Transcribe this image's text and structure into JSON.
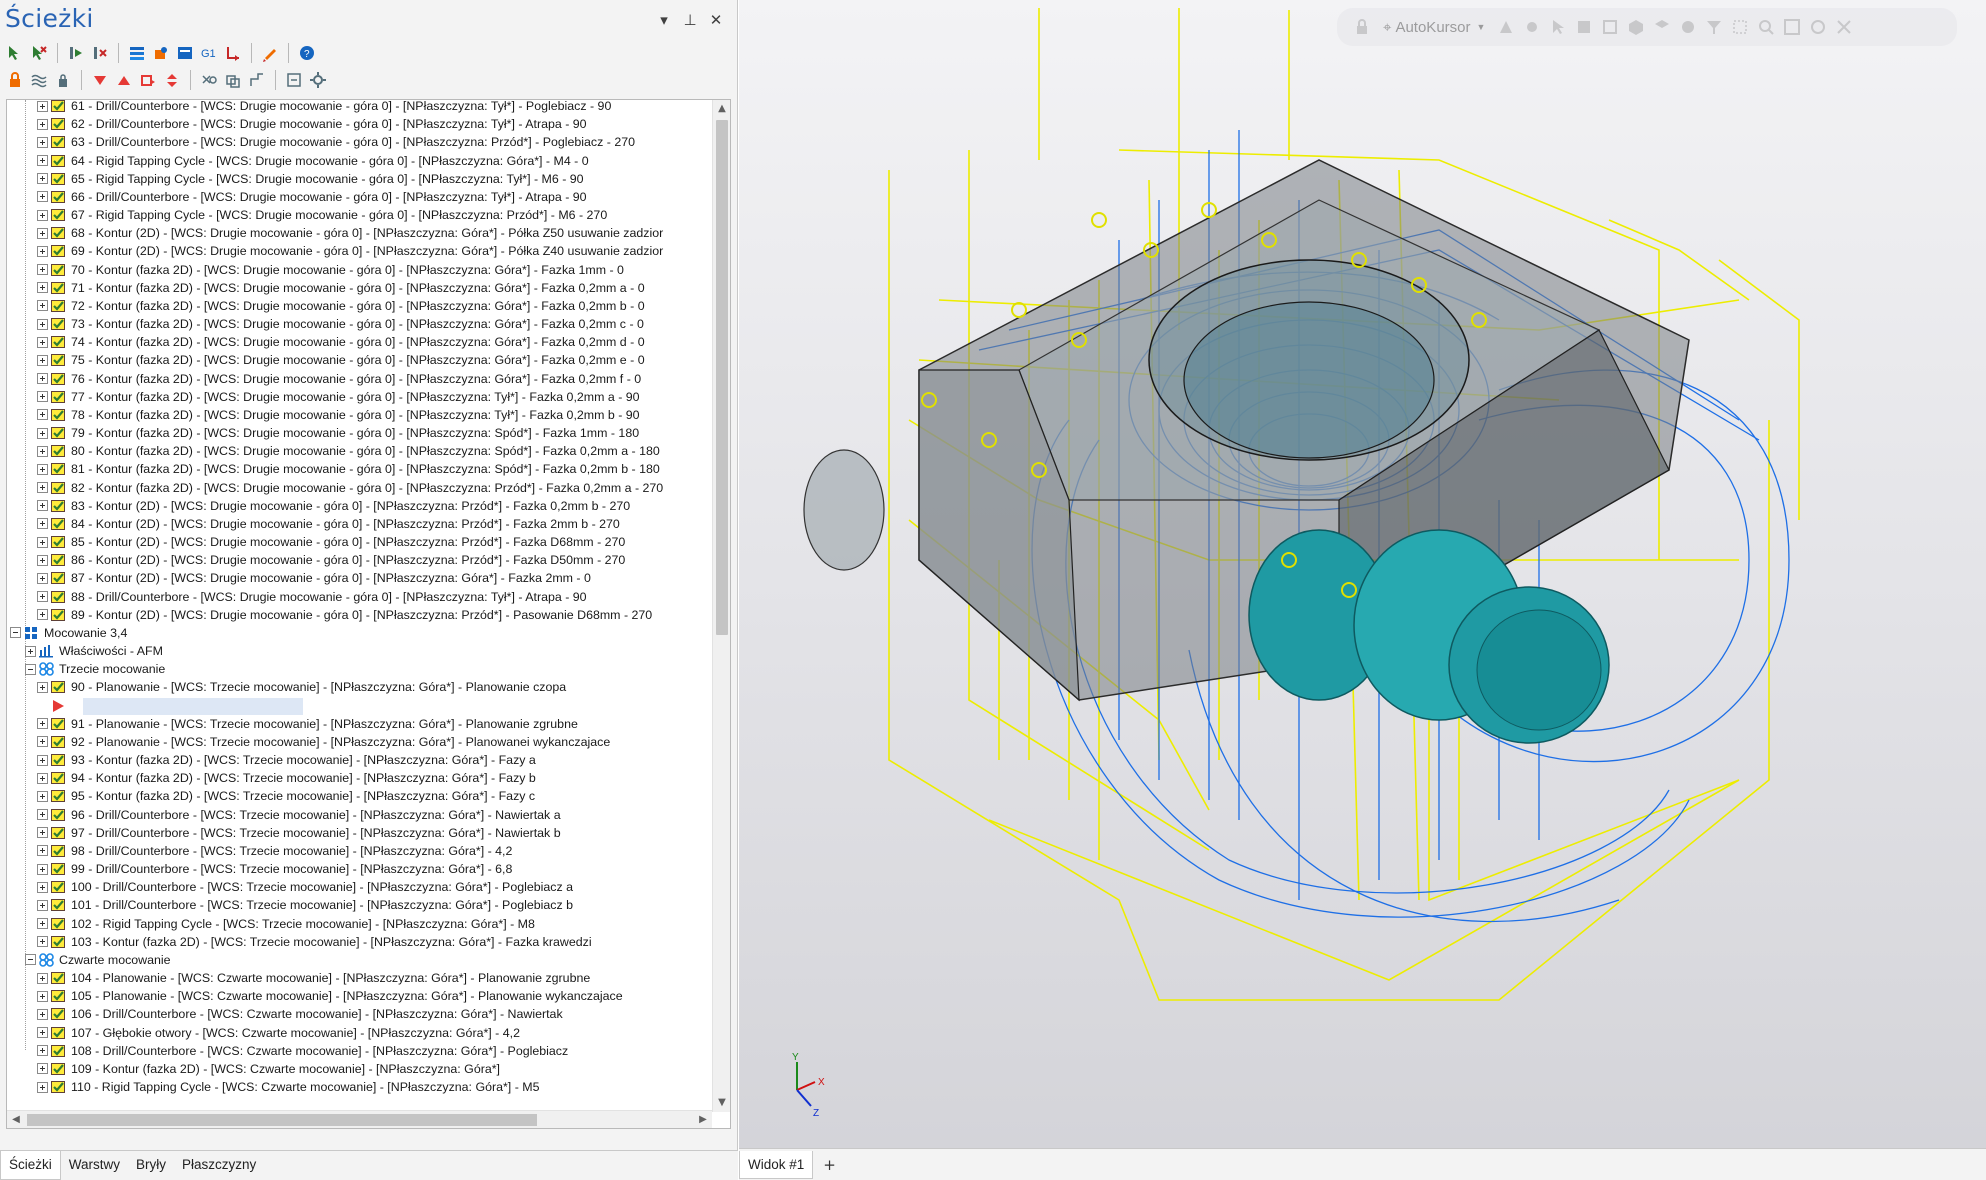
{
  "panel": {
    "title": "Ścieżki",
    "controls": {
      "menu": "▾",
      "pin": "⊥",
      "close": "✕"
    }
  },
  "toolbar_row_1": [
    {
      "name": "select-toolpath-icon"
    },
    {
      "name": "deselect-toolpath-icon"
    },
    {
      "sep": true
    },
    {
      "name": "regenerate-icon"
    },
    {
      "name": "delete-toolpath-icon"
    },
    {
      "sep": true
    },
    {
      "name": "layers-icon"
    },
    {
      "name": "stock-icon"
    },
    {
      "name": "simulate-icon"
    },
    {
      "name": "g1-icon"
    },
    {
      "name": "post-icon"
    },
    {
      "sep": true
    },
    {
      "name": "edit-icon"
    },
    {
      "sep": true
    },
    {
      "name": "help-icon"
    }
  ],
  "toolbar_row_2": [
    {
      "name": "lock-icon"
    },
    {
      "name": "wave-icon"
    },
    {
      "name": "padlock-icon"
    },
    {
      "sep": true
    },
    {
      "name": "move-down-icon"
    },
    {
      "name": "move-up-icon"
    },
    {
      "name": "move-to-icon"
    },
    {
      "name": "reorder-icon"
    },
    {
      "sep": true
    },
    {
      "name": "copy-icon"
    },
    {
      "name": "link-icon"
    },
    {
      "name": "attach-icon"
    },
    {
      "sep": true
    },
    {
      "name": "tool-icon"
    },
    {
      "name": "settings-icon"
    }
  ],
  "tree": {
    "operations_a": [
      "61 - Drill/Counterbore - [WCS: Drugie mocowanie - góra 0] - [NPłaszczyzna: Tył*] - Poglebiacz - 90",
      "62 - Drill/Counterbore - [WCS: Drugie mocowanie - góra 0] - [NPłaszczyzna: Tył*] - Atrapa - 90",
      "63 - Drill/Counterbore - [WCS: Drugie mocowanie - góra 0] - [NPłaszczyzna: Przód*] - Poglebiacz - 270",
      "64 - Rigid Tapping Cycle - [WCS: Drugie mocowanie - góra 0] - [NPłaszczyzna: Góra*] - M4 - 0",
      "65 - Rigid Tapping Cycle - [WCS: Drugie mocowanie - góra 0] - [NPłaszczyzna: Tył*] - M6 - 90",
      "66 - Drill/Counterbore - [WCS: Drugie mocowanie - góra 0] - [NPłaszczyzna: Tył*] - Atrapa - 90",
      "67 - Rigid Tapping Cycle - [WCS: Drugie mocowanie - góra 0] - [NPłaszczyzna: Przód*] - M6 - 270",
      "68 - Kontur (2D) - [WCS: Drugie mocowanie - góra 0] - [NPłaszczyzna: Góra*] - Półka Z50 usuwanie zadzior",
      "69 - Kontur (2D) - [WCS: Drugie mocowanie - góra 0] - [NPłaszczyzna: Góra*] - Półka Z40 usuwanie zadzior",
      "70 - Kontur (fazka 2D) - [WCS: Drugie mocowanie - góra 0] - [NPłaszczyzna: Góra*] - Fazka 1mm - 0",
      "71 - Kontur (fazka 2D) - [WCS: Drugie mocowanie - góra 0] - [NPłaszczyzna: Góra*] - Fazka 0,2mm a - 0",
      "72 - Kontur (fazka 2D) - [WCS: Drugie mocowanie - góra 0] - [NPłaszczyzna: Góra*] - Fazka 0,2mm b - 0",
      "73 - Kontur (fazka 2D) - [WCS: Drugie mocowanie - góra 0] - [NPłaszczyzna: Góra*] - Fazka 0,2mm c - 0",
      "74 - Kontur (fazka 2D) - [WCS: Drugie mocowanie - góra 0] - [NPłaszczyzna: Góra*] - Fazka 0,2mm d - 0",
      "75 - Kontur (fazka 2D) - [WCS: Drugie mocowanie - góra 0] - [NPłaszczyzna: Góra*] - Fazka 0,2mm e - 0",
      "76 - Kontur (fazka 2D) - [WCS: Drugie mocowanie - góra 0] - [NPłaszczyzna: Góra*] - Fazka 0,2mm f - 0",
      "77 - Kontur (fazka 2D) - [WCS: Drugie mocowanie - góra 0] - [NPłaszczyzna: Tył*] - Fazka 0,2mm a - 90",
      "78 - Kontur (fazka 2D) - [WCS: Drugie mocowanie - góra 0] - [NPłaszczyzna: Tył*] - Fazka 0,2mm b - 90",
      "79 - Kontur (fazka 2D) - [WCS: Drugie mocowanie - góra 0] - [NPłaszczyzna: Spód*] - Fazka 1mm - 180",
      "80 - Kontur (fazka 2D) - [WCS: Drugie mocowanie - góra 0] - [NPłaszczyzna: Spód*] - Fazka 0,2mm a - 180",
      "81 - Kontur (fazka 2D) - [WCS: Drugie mocowanie - góra 0] - [NPłaszczyzna: Spód*] - Fazka 0,2mm b - 180",
      "82 - Kontur (fazka 2D) - [WCS: Drugie mocowanie - góra 0] - [NPłaszczyzna: Przód*] - Fazka 0,2mm a - 270",
      "83 - Kontur (2D) - [WCS: Drugie mocowanie - góra 0] - [NPłaszczyzna: Przód*] - Fazka 0,2mm b - 270",
      "84 - Kontur (2D) - [WCS: Drugie mocowanie - góra 0] - [NPłaszczyzna: Przód*] - Fazka 2mm b - 270",
      "85 - Kontur (2D) - [WCS: Drugie mocowanie - góra 0] - [NPłaszczyzna: Przód*] - Fazka D68mm - 270",
      "86 - Kontur (2D) - [WCS: Drugie mocowanie - góra 0] - [NPłaszczyzna: Przód*] - Fazka D50mm - 270",
      "87 - Kontur (2D) - [WCS: Drugie mocowanie - góra 0] - [NPłaszczyzna: Góra*] - Fazka 2mm - 0",
      "88 - Drill/Counterbore - [WCS: Drugie mocowanie - góra 0] - [NPłaszczyzna: Tył*] - Atrapa - 90",
      "89 - Kontur (2D) - [WCS: Drugie mocowanie - góra 0] - [NPłaszczyzna: Przód*] - Pasowanie D68mm - 270"
    ],
    "group_label": "Mocowanie 3,4",
    "properties_label": "Właściwości - AFM",
    "setup3_label": "Trzecie mocowanie",
    "setup3_ops_first": [
      "90 - Planowanie - [WCS: Trzecie mocowanie] - [NPłaszczyzna: Góra*] - Planowanie czopa"
    ],
    "setup3_ops": [
      "91 - Planowanie - [WCS: Trzecie mocowanie] - [NPłaszczyzna: Góra*] - Planowanie zgrubne",
      "92 - Planowanie - [WCS: Trzecie mocowanie] - [NPłaszczyzna: Góra*] - Planowanei wykanczajace",
      "93 - Kontur (fazka 2D) - [WCS: Trzecie mocowanie] - [NPłaszczyzna: Góra*] - Fazy a",
      "94 - Kontur (fazka 2D) - [WCS: Trzecie mocowanie] - [NPłaszczyzna: Góra*] - Fazy b",
      "95 - Kontur (fazka 2D) - [WCS: Trzecie mocowanie] - [NPłaszczyzna: Góra*] - Fazy c",
      "96 - Drill/Counterbore - [WCS: Trzecie mocowanie] - [NPłaszczyzna: Góra*] - Nawiertak a",
      "97 - Drill/Counterbore - [WCS: Trzecie mocowanie] - [NPłaszczyzna: Góra*] - Nawiertak b",
      "98 - Drill/Counterbore - [WCS: Trzecie mocowanie] - [NPłaszczyzna: Góra*] - 4,2",
      "99 - Drill/Counterbore - [WCS: Trzecie mocowanie] - [NPłaszczyzna: Góra*] - 6,8",
      "100 - Drill/Counterbore - [WCS: Trzecie mocowanie] - [NPłaszczyzna: Góra*] - Poglebiacz a",
      "101 - Drill/Counterbore - [WCS: Trzecie mocowanie] - [NPłaszczyzna: Góra*] - Poglebiacz b",
      "102 - Rigid Tapping Cycle - [WCS: Trzecie mocowanie] - [NPłaszczyzna: Góra*] - M8",
      "103 - Kontur (fazka 2D) - [WCS: Trzecie mocowanie] - [NPłaszczyzna: Góra*] - Fazka krawedzi"
    ],
    "setup4_label": "Czwarte mocowanie",
    "setup4_ops": [
      "104 - Planowanie - [WCS: Czwarte mocowanie] - [NPłaszczyzna: Góra*] - Planowanie zgrubne",
      "105 - Planowanie - [WCS: Czwarte mocowanie] - [NPłaszczyzna: Góra*] - Planowanie wykanczajace",
      "106 - Drill/Counterbore - [WCS: Czwarte mocowanie] - [NPłaszczyzna: Góra*] - Nawiertak",
      "107 - Głębokie otwory - [WCS: Czwarte mocowanie] - [NPłaszczyzna: Góra*] - 4,2",
      "108 - Drill/Counterbore - [WCS: Czwarte mocowanie] - [NPłaszczyzna: Góra*] - Poglebiacz",
      "109 - Kontur (fazka 2D) - [WCS: Czwarte mocowanie] - [NPłaszczyzna: Góra*]",
      "110 - Rigid Tapping Cycle - [WCS: Czwarte mocowanie] - [NPłaszczyzna: Góra*] - M5"
    ]
  },
  "bottom_tabs": [
    "Ścieżki",
    "Warstwy",
    "Bryły",
    "Płaszczyzny"
  ],
  "viewport": {
    "autokursor_label": "AutoKursor",
    "axes": {
      "x": "X",
      "y": "Y",
      "z": "Z"
    },
    "colors": {
      "toolpath_blue": "#1e6fe6",
      "stock_yellow": "#f0f000",
      "part_teal": "#27a9b0",
      "part_gray": "#6b7378"
    }
  },
  "viewport_tabs": {
    "active": "Widok #1",
    "add": "+"
  }
}
